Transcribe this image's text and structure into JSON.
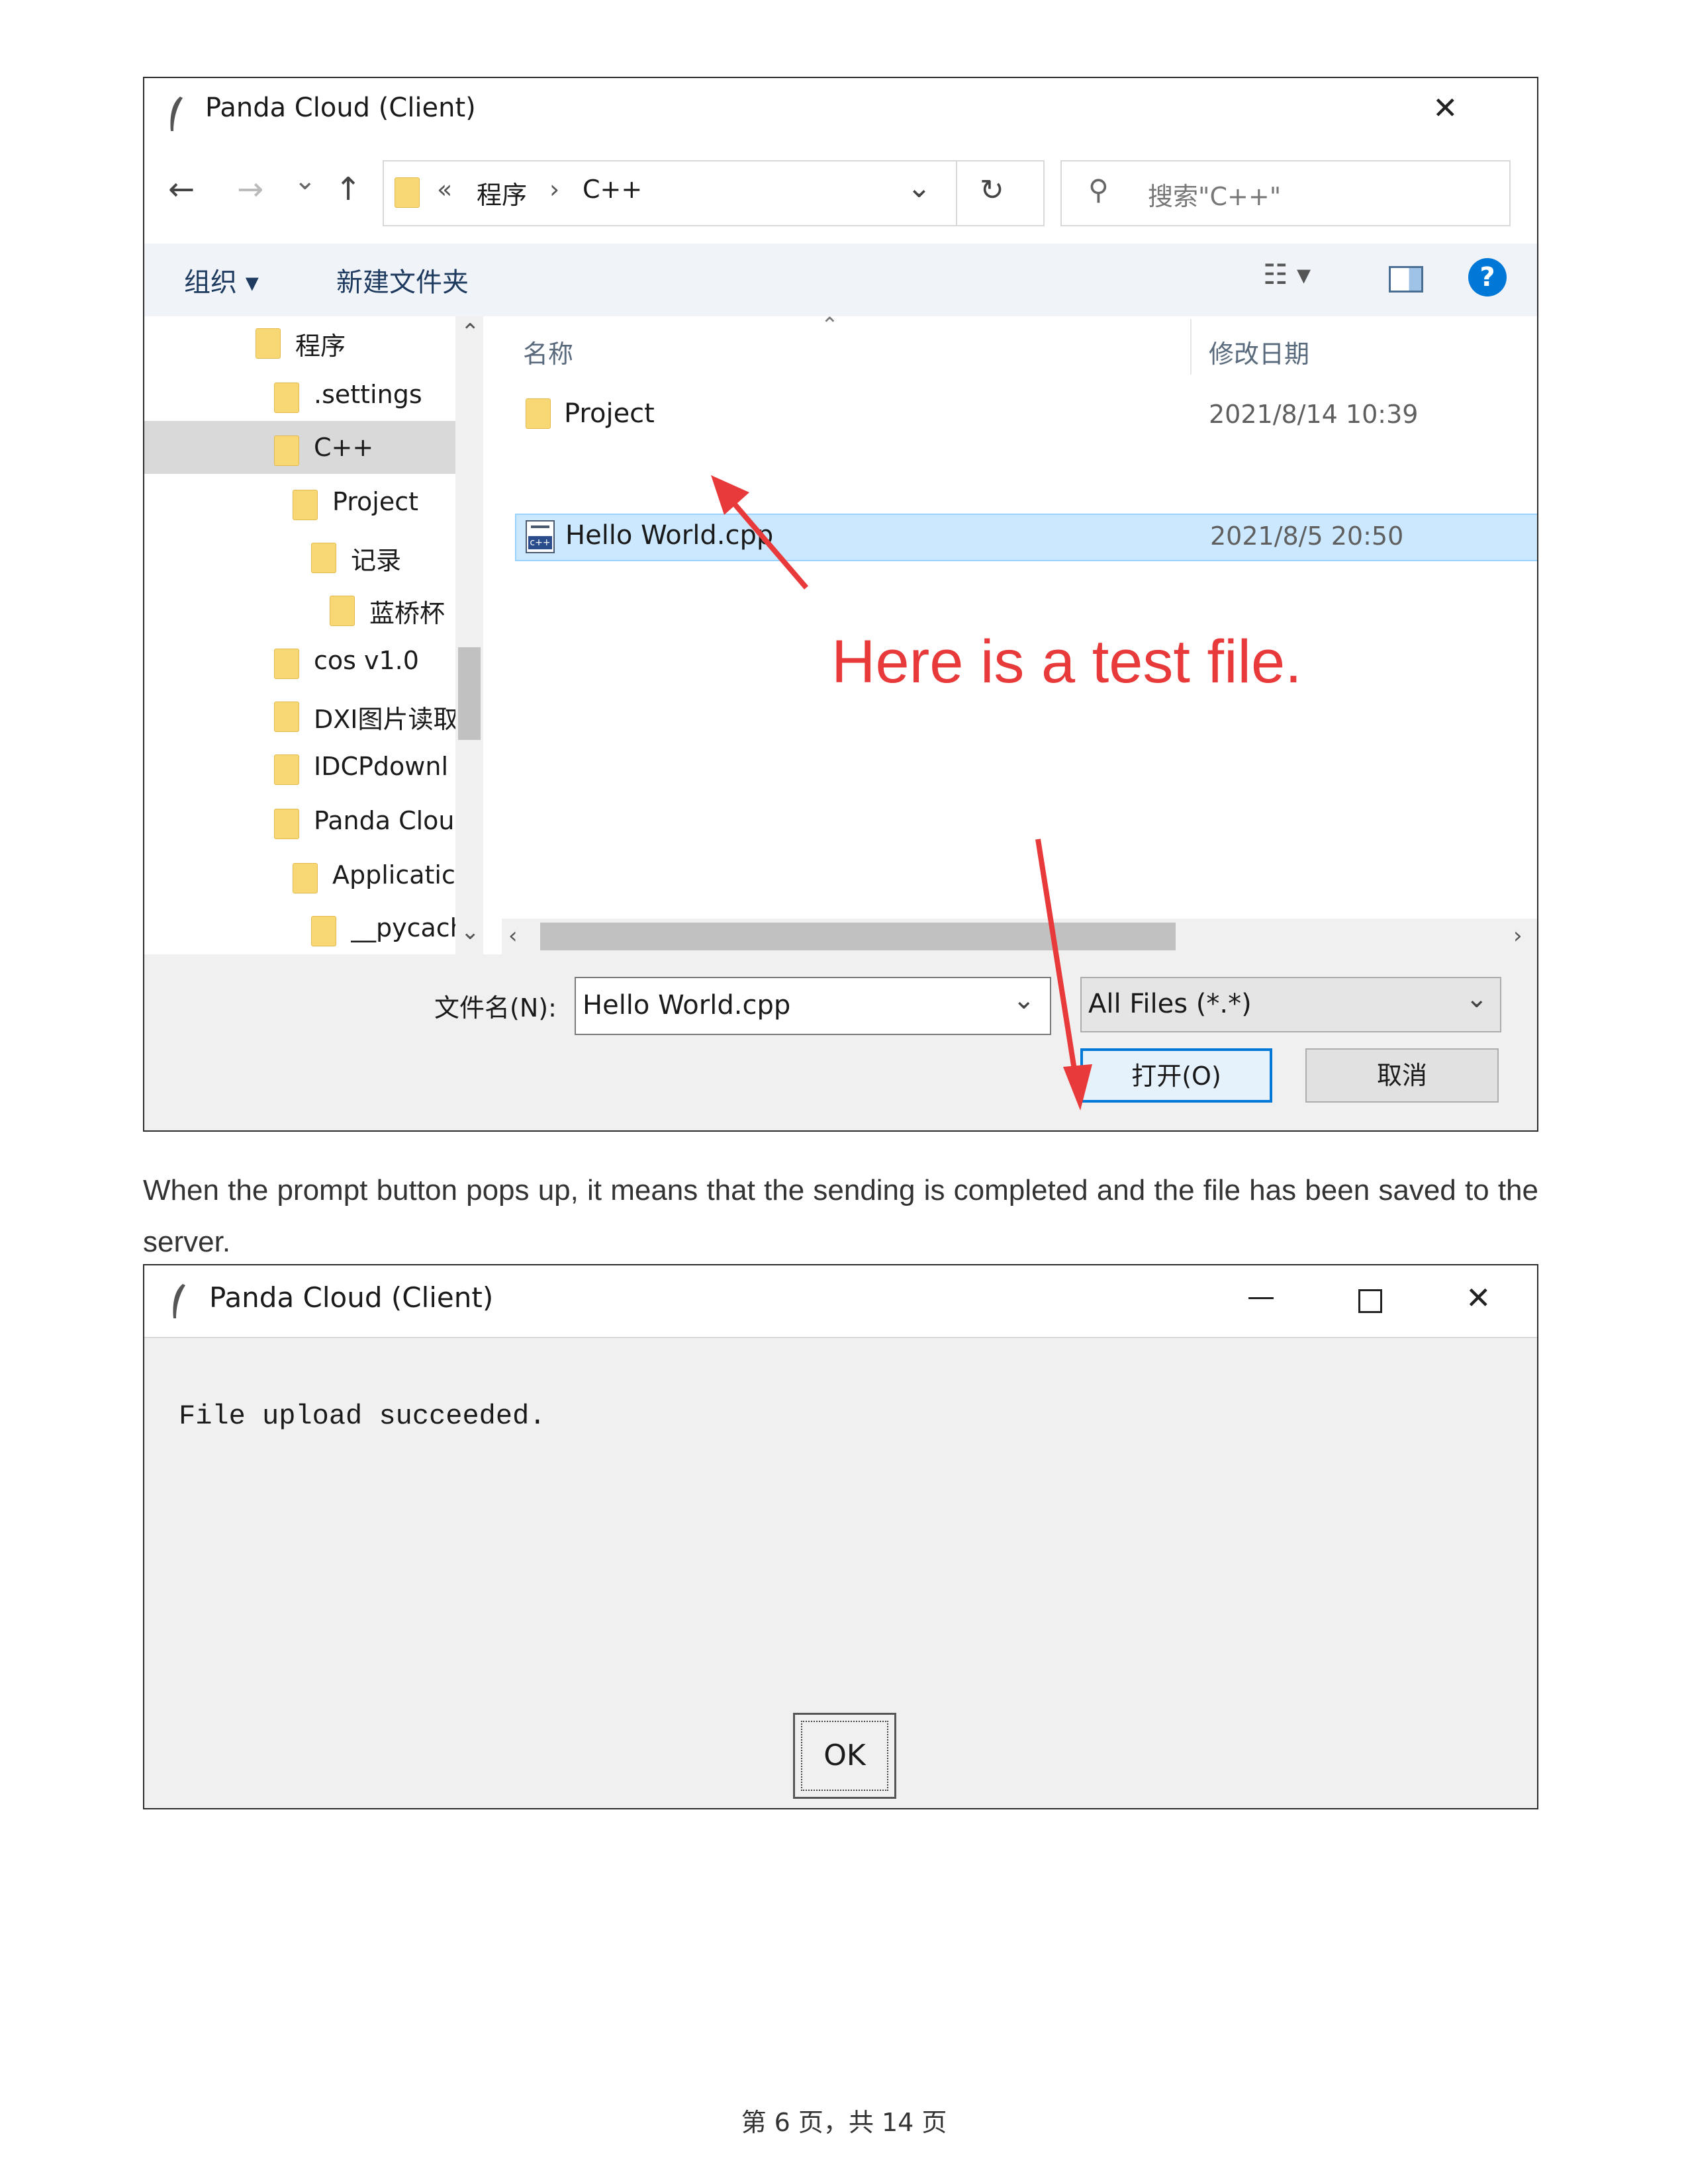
{
  "dialog1": {
    "title": "Panda Cloud (Client)",
    "close_glyph": "✕",
    "nav": {
      "back": "←",
      "forward": "→",
      "recent": "⌄",
      "up": "↑"
    },
    "breadcrumb": {
      "prefix": "«",
      "part1": "程序",
      "sep": "›",
      "part2": "C++"
    },
    "search_placeholder": "搜索\"C++\"",
    "toolbar": {
      "organize": "组织 ▾",
      "new_folder": "新建文件夹",
      "view": "☷ ▾",
      "help": "?"
    },
    "tree": {
      "items": [
        "程序",
        ".settings",
        "C++",
        "Project",
        "记录",
        "蓝桥杯",
        "cos v1.0",
        "DXI图片读取",
        "IDCPdownl",
        "Panda Clou",
        "Applicatic",
        "__pycach"
      ]
    },
    "columns": {
      "name": "名称",
      "date": "修改日期"
    },
    "files": [
      {
        "name": "Project",
        "date": "2021/8/14 10:39"
      },
      {
        "name": "Hello World.cpp",
        "date": "2021/8/5 20:50"
      }
    ],
    "annotation": "Here is a test file.",
    "filename_label": "文件名(N):",
    "filename_value": "Hello World.cpp",
    "filetype_value": "All Files (*.*)",
    "open_button": "打开(O)",
    "cancel_button": "取消"
  },
  "caption": "When the prompt button pops up, it means that the sending is completed and the file has been saved to the server.",
  "dialog2": {
    "title": "Panda Cloud (Client)",
    "minimize_glyph": "—",
    "maximize_glyph": "☐",
    "close_glyph": "✕",
    "message": "File upload succeeded.",
    "ok_button": "OK"
  },
  "footer": "第 6 页，共 14 页",
  "colors": {
    "accent": "#0078d7",
    "annotation_red": "#e83a3a",
    "selection": "#cce8ff"
  }
}
